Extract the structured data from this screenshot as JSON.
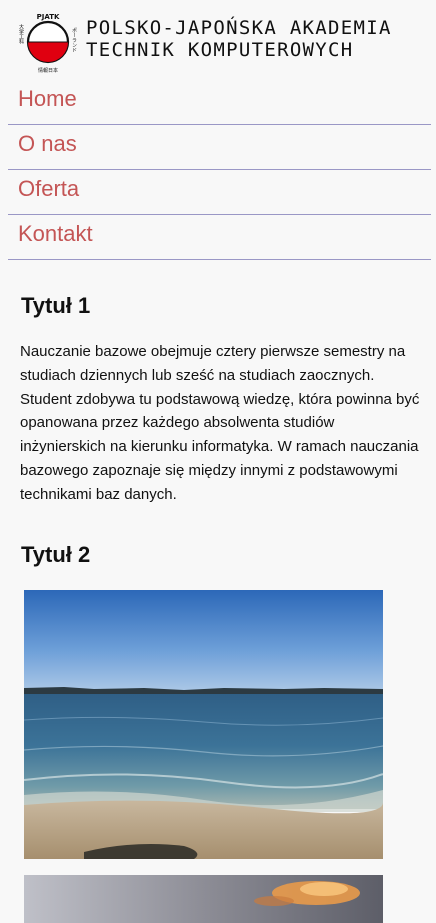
{
  "header": {
    "brand_line1": "POLSKO-JAPOŃSKA AKADEMIA",
    "brand_line2": "TECHNIK KOMPUTEROWYCH",
    "logo_text_top": "PJATK",
    "logo_text_right": "ポーランド",
    "logo_text_left": "大学工科",
    "logo_text_bottom": "情報日本"
  },
  "nav": {
    "items": [
      {
        "label": "Home"
      },
      {
        "label": "O nas"
      },
      {
        "label": "Oferta"
      },
      {
        "label": "Kontakt"
      }
    ]
  },
  "main": {
    "section1": {
      "title": "Tytuł 1",
      "paragraph": "Nauczanie bazowe obejmuje cztery pierwsze semestry na studiach dziennych lub sześć na studiach zaocznych. Student zdobywa tu podstawową wiedzę, która powinna być opanowana przez każdego absolwenta studiów inżynierskich na kierunku informatyka. W ramach nauczania bazowego zapoznaje się między innymi z podstawowymi technikami baz danych."
    },
    "section2": {
      "title": "Tytuł 2"
    }
  },
  "colors": {
    "link": "#c45555",
    "divider": "#9a97c6",
    "logo_red": "#e00010",
    "background": "#f8f8f8"
  }
}
